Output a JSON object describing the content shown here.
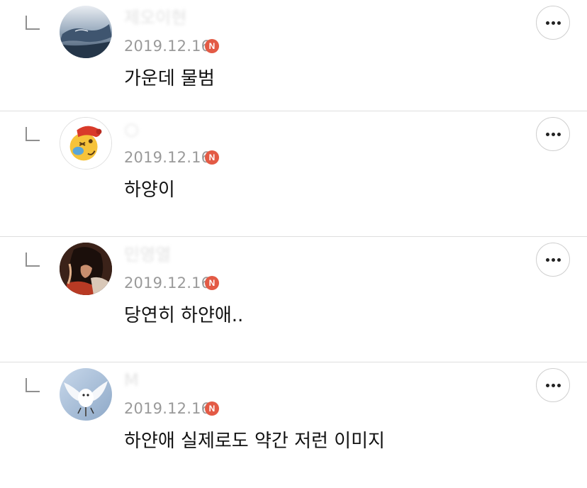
{
  "comments": [
    {
      "nickname": "제오이현",
      "date": "2019.12.16",
      "badge": "N",
      "text": "가운데 물범",
      "avatar": "whale-photo-avatar"
    },
    {
      "nickname": "○",
      "date": "2019.12.16",
      "badge": "N",
      "text": "하양이",
      "avatar": "cartoon-character-avatar"
    },
    {
      "nickname": "민영열",
      "date": "2019.12.16",
      "badge": "N",
      "text": "당연히 하얀애..",
      "avatar": "portrait-photo-avatar"
    },
    {
      "nickname": "M",
      "date": "2019.12.16",
      "badge": "N",
      "text": "하얀애 실제로도 약간 저런 이미지",
      "avatar": "white-bird-avatar"
    }
  ],
  "icons": {
    "reply": "reply-arrow-icon",
    "more": "more-options-icon",
    "new_badge": "new-badge-icon"
  },
  "colors": {
    "badge": "#e35a45",
    "date": "#9a9a9a",
    "divider": "#dedede"
  }
}
